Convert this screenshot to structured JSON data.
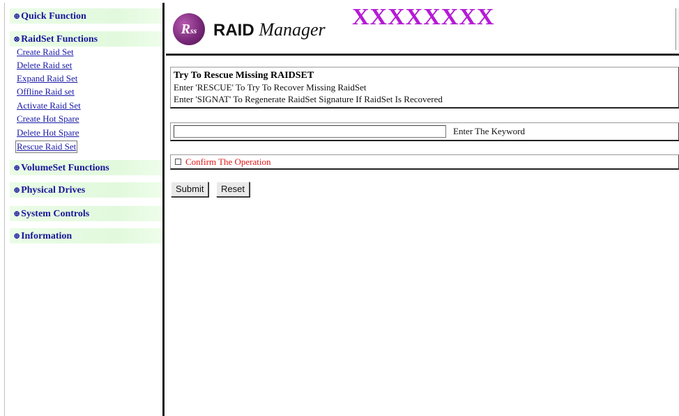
{
  "sidebar": {
    "sections": [
      {
        "symbol": "⊕",
        "label": "Quick Function"
      },
      {
        "symbol": "⊗",
        "label": "RaidSet Functions"
      },
      {
        "symbol": "⊕",
        "label": "VolumeSet Functions"
      },
      {
        "symbol": "⊕",
        "label": "Physical Drives"
      },
      {
        "symbol": "⊕",
        "label": "System Controls"
      },
      {
        "symbol": "⊕",
        "label": "Information"
      }
    ],
    "raidset_links": [
      "Create Raid Set",
      "Delete Raid set",
      "Expand Raid Set",
      "Offline Raid set",
      "Activate Raid Set",
      "Create Hot Spare",
      "Delete Hot Spare",
      "Rescue Raid Set"
    ],
    "active_link": "Rescue Raid Set"
  },
  "header": {
    "logo_badge": "R",
    "logo_badge_small": "ss",
    "logo_text_bold": "RAID",
    "logo_text_script": "Manager",
    "product_title": "XXXXXXXX"
  },
  "rescue": {
    "title": "Try To Rescue Missing RAIDSET",
    "line1": "Enter 'RESCUE' To Try To Recover Missing RaidSet",
    "line2": "Enter 'SIGNAT' To Regenerate RaidSet Signature If RaidSet Is Recovered"
  },
  "keyword": {
    "value": "",
    "label": "Enter The Keyword"
  },
  "confirm": {
    "checked": false,
    "label": "Confirm The Operation"
  },
  "buttons": {
    "submit": "Submit",
    "reset": "Reset"
  },
  "colors": {
    "nav_header_bg": "#e2f9dd",
    "nav_text": "#17179a",
    "product_title": "#b51ad6",
    "confirm_text": "#e01515",
    "logo_badge": "#7a2a7a"
  }
}
